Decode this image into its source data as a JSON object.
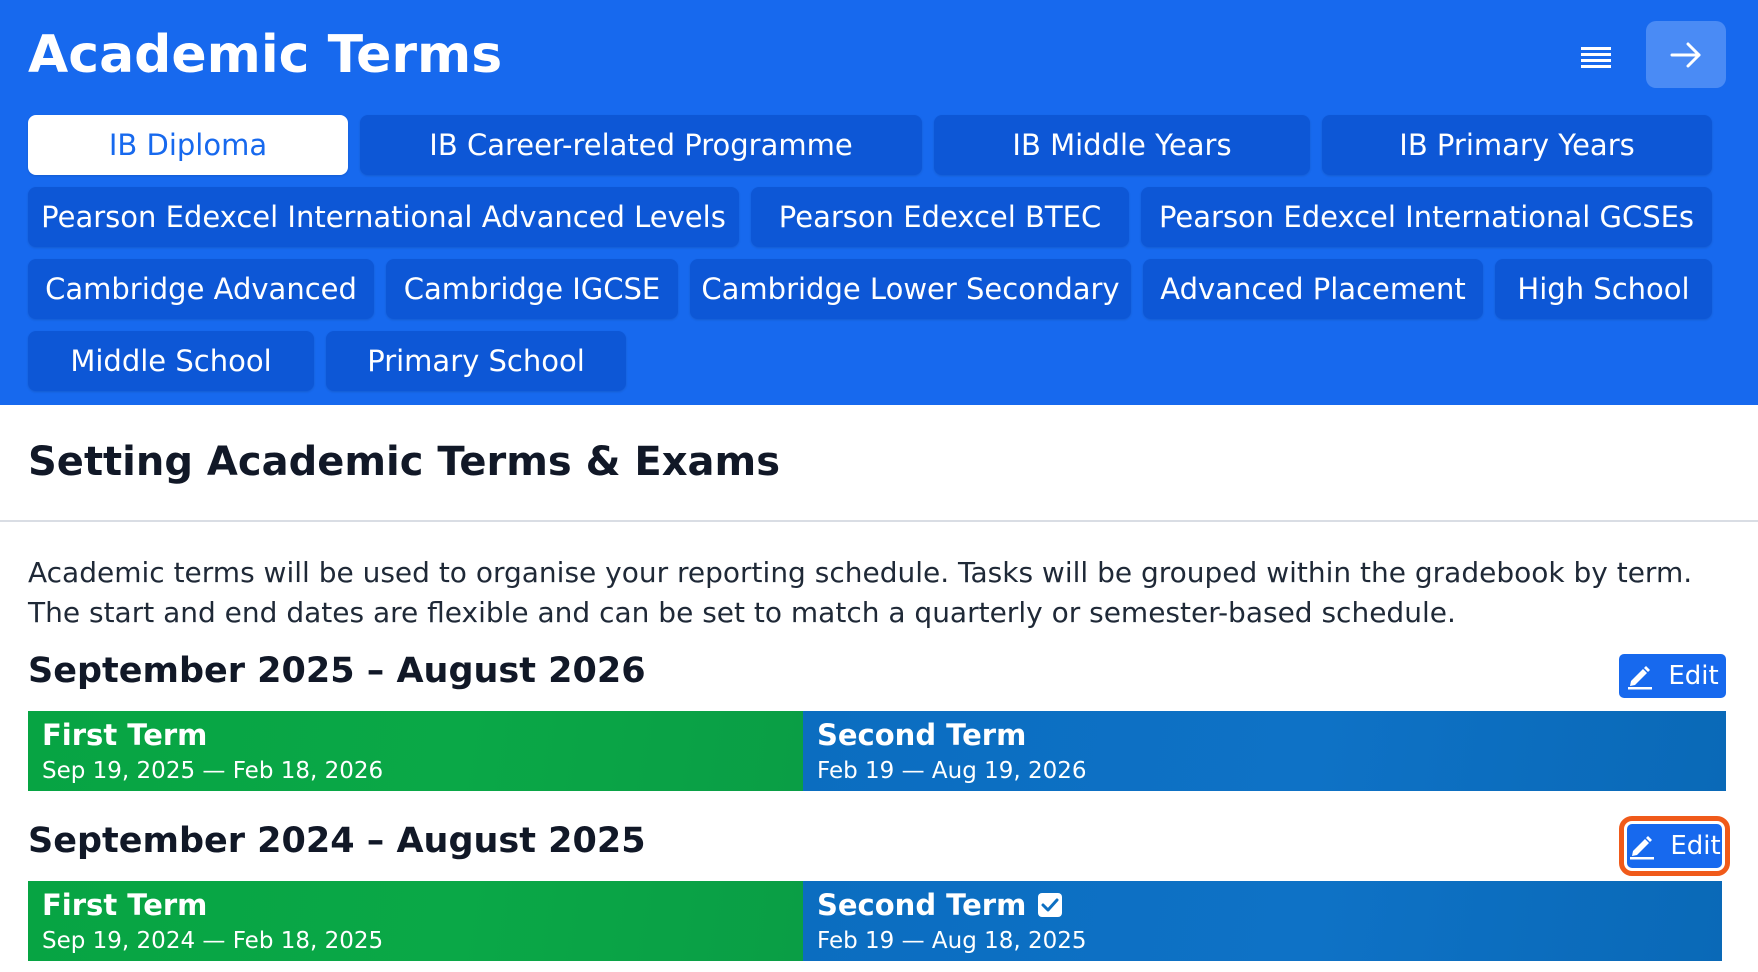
{
  "header": {
    "title": "Academic Terms",
    "background_color": "#1769ee",
    "menu_icon": "list-icon",
    "forward_icon": "arrow-right-icon"
  },
  "curriculum_tabs": [
    {
      "label": "IB Diploma",
      "active": true
    },
    {
      "label": "IB Career-related Programme",
      "active": false
    },
    {
      "label": "IB Middle Years",
      "active": false
    },
    {
      "label": "IB Primary Years",
      "active": false
    },
    {
      "label": "Pearson Edexcel International Advanced Levels",
      "active": false
    },
    {
      "label": "Pearson Edexcel BTEC",
      "active": false
    },
    {
      "label": "Pearson Edexcel International GCSEs",
      "active": false
    },
    {
      "label": "Cambridge Advanced",
      "active": false
    },
    {
      "label": "Cambridge IGCSE",
      "active": false
    },
    {
      "label": "Cambridge Lower Secondary",
      "active": false
    },
    {
      "label": "Advanced Placement",
      "active": false
    },
    {
      "label": "High School",
      "active": false
    },
    {
      "label": "Middle School",
      "active": false
    },
    {
      "label": "Primary School",
      "active": false
    }
  ],
  "main": {
    "section_title": "Setting Academic Terms & Exams",
    "description": "Academic terms will be used to organise your reporting schedule. Tasks will be grouped within the gradebook by term. The start and end dates are flexible and can be set to match a quarterly or semester-based schedule."
  },
  "academic_years": [
    {
      "title": "September 2025 – August 2026",
      "edit_label": "Edit",
      "terms": [
        {
          "name": "First Term",
          "dates": "Sep 19, 2025 — Feb 18, 2026",
          "color": "#08a545",
          "checked": false
        },
        {
          "name": "Second Term",
          "dates": "Feb 19 — Aug 19, 2026",
          "color": "#0c6fc2",
          "checked": false
        }
      ]
    },
    {
      "title": "September 2024 – August 2025",
      "edit_label": "Edit",
      "terms": [
        {
          "name": "First Term",
          "dates": "Sep 19, 2024 — Feb 18, 2025",
          "color": "#08a545",
          "checked": false
        },
        {
          "name": "Second Term",
          "dates": "Feb 19 — Aug 18, 2025",
          "color": "#0c6fc2",
          "checked": true
        }
      ]
    }
  ]
}
